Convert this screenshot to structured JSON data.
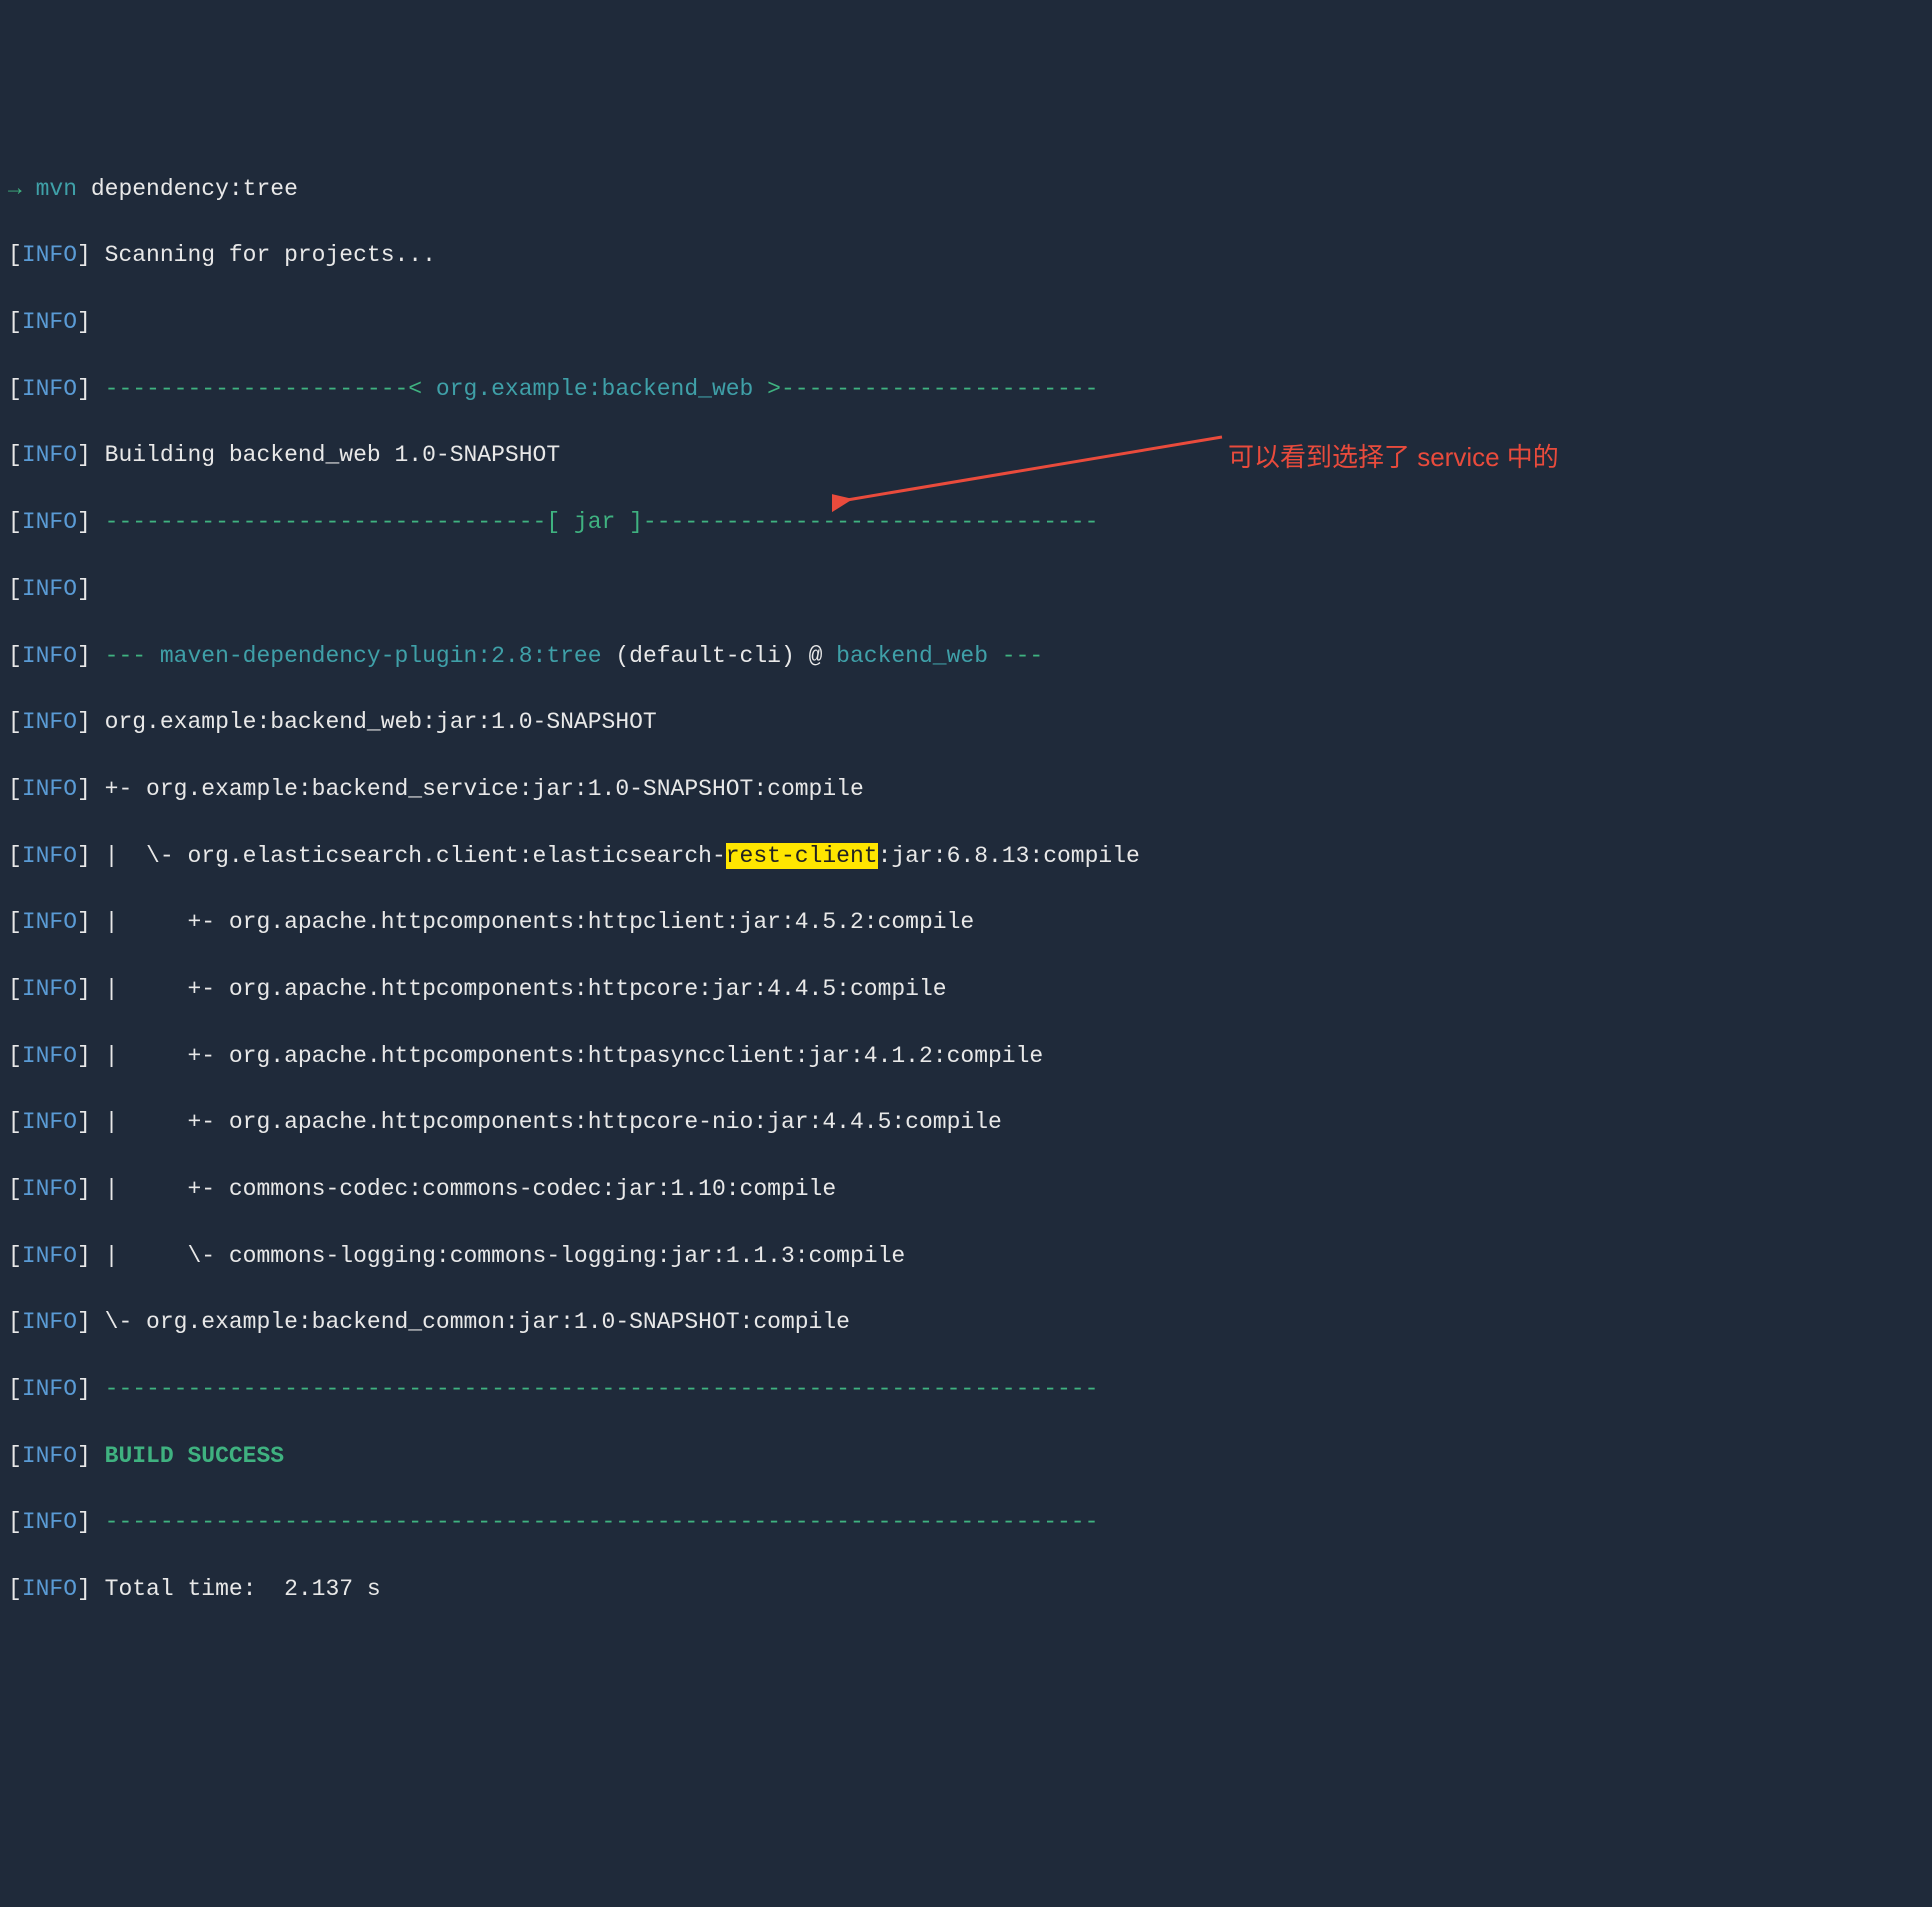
{
  "prompt": {
    "arrow": "→",
    "cmd": "mvn",
    "args": " dependency:tree"
  },
  "info_label": "INFO",
  "lines": {
    "scan": " Scanning for projects...",
    "sep_proj_pre": " ----------------------< ",
    "sep_proj_name": "org.example:backend_web",
    "sep_proj_post": " >-----------------------",
    "building": " Building backend_web 1.0-SNAPSHOT",
    "sep_jar": " --------------------------------[ jar ]---------------------------------",
    "plugin_pre": " --- ",
    "plugin_name": "maven-dependency-plugin:2.8:tree",
    "plugin_mid": " (default-cli) @ ",
    "plugin_proj": "backend_web",
    "plugin_post": " ---",
    "root": " org.example:backend_web:jar:1.0-SNAPSHOT",
    "d1": " +- org.example:backend_service:jar:1.0-SNAPSHOT:compile",
    "d2a": " |  \\- org.elasticsearch.client:elasticsearch-",
    "d2hl": "rest-client",
    "d2b": ":jar:6.8.13:compile",
    "d3": " |     +- org.apache.httpcomponents:httpclient:jar:4.5.2:compile",
    "d4": " |     +- org.apache.httpcomponents:httpcore:jar:4.4.5:compile",
    "d5": " |     +- org.apache.httpcomponents:httpasyncclient:jar:4.1.2:compile",
    "d6": " |     +- org.apache.httpcomponents:httpcore-nio:jar:4.4.5:compile",
    "d7": " |     +- commons-codec:commons-codec:jar:1.10:compile",
    "d8": " |     \\- commons-logging:commons-logging:jar:1.1.3:compile",
    "d9": " \\- org.example:backend_common:jar:1.0-SNAPSHOT:compile",
    "sep_line": " ------------------------------------------------------------------------",
    "success": " BUILD SUCCESS",
    "total_time": " Total time:  2.137 s"
  },
  "annotation": "可以看到选择了 service 中的"
}
